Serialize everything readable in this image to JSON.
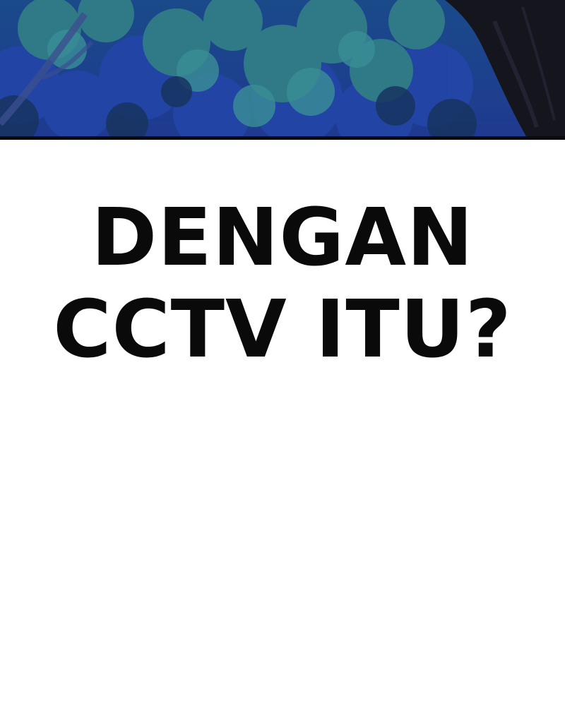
{
  "panel": {
    "illustration": "night-forest-foliage-with-tree-trunk",
    "colors": {
      "sky_blue": "#1d3d86",
      "foliage_teal": "#2f7a86",
      "foliage_dark": "#173460",
      "trunk": "#15151d",
      "border": "#0b0b0d"
    }
  },
  "caption": {
    "line1": "DENGAN",
    "line2": "CCTV ITU?",
    "color": "#0a0a0a"
  }
}
